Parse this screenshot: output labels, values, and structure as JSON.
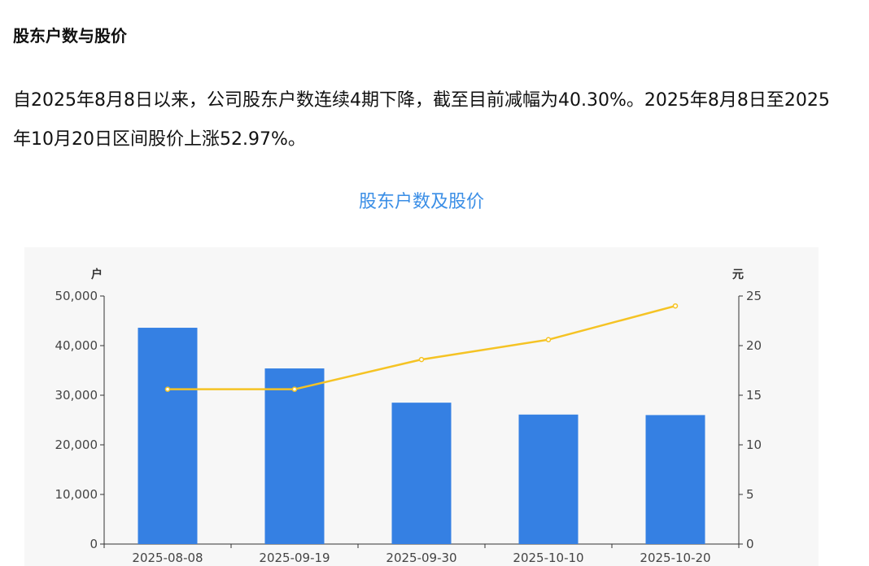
{
  "section": {
    "title": "股东户数与股价"
  },
  "summary": {
    "text": "自2025年8月8日以来，公司股东户数连续4期下降，截至目前减幅为40.30%。2025年8月8日至2025年10月20日区间股价上涨52.97%。"
  },
  "chart_data": {
    "type": "bar",
    "title": "股东户数及股价",
    "categories": [
      "2025-08-08",
      "2025-09-19",
      "2025-09-30",
      "2025-10-10",
      "2025-10-20"
    ],
    "series": [
      {
        "type": "bar",
        "axis": "left",
        "color": "#3580e3",
        "values": [
          43600,
          35400,
          28500,
          26100,
          26000
        ]
      },
      {
        "type": "line",
        "axis": "right",
        "color": "#f5c324",
        "values": [
          15.6,
          15.6,
          18.6,
          20.6,
          24.0
        ]
      }
    ],
    "y_left": {
      "unit": "户",
      "ylim": [
        0,
        50000
      ],
      "ticks": [
        "0",
        "10,000",
        "20,000",
        "30,000",
        "40,000",
        "50,000"
      ]
    },
    "y_right": {
      "unit": "元",
      "ylim": [
        0,
        25
      ],
      "ticks": [
        "0",
        "5",
        "10",
        "15",
        "20",
        "25"
      ]
    },
    "grid": false
  }
}
